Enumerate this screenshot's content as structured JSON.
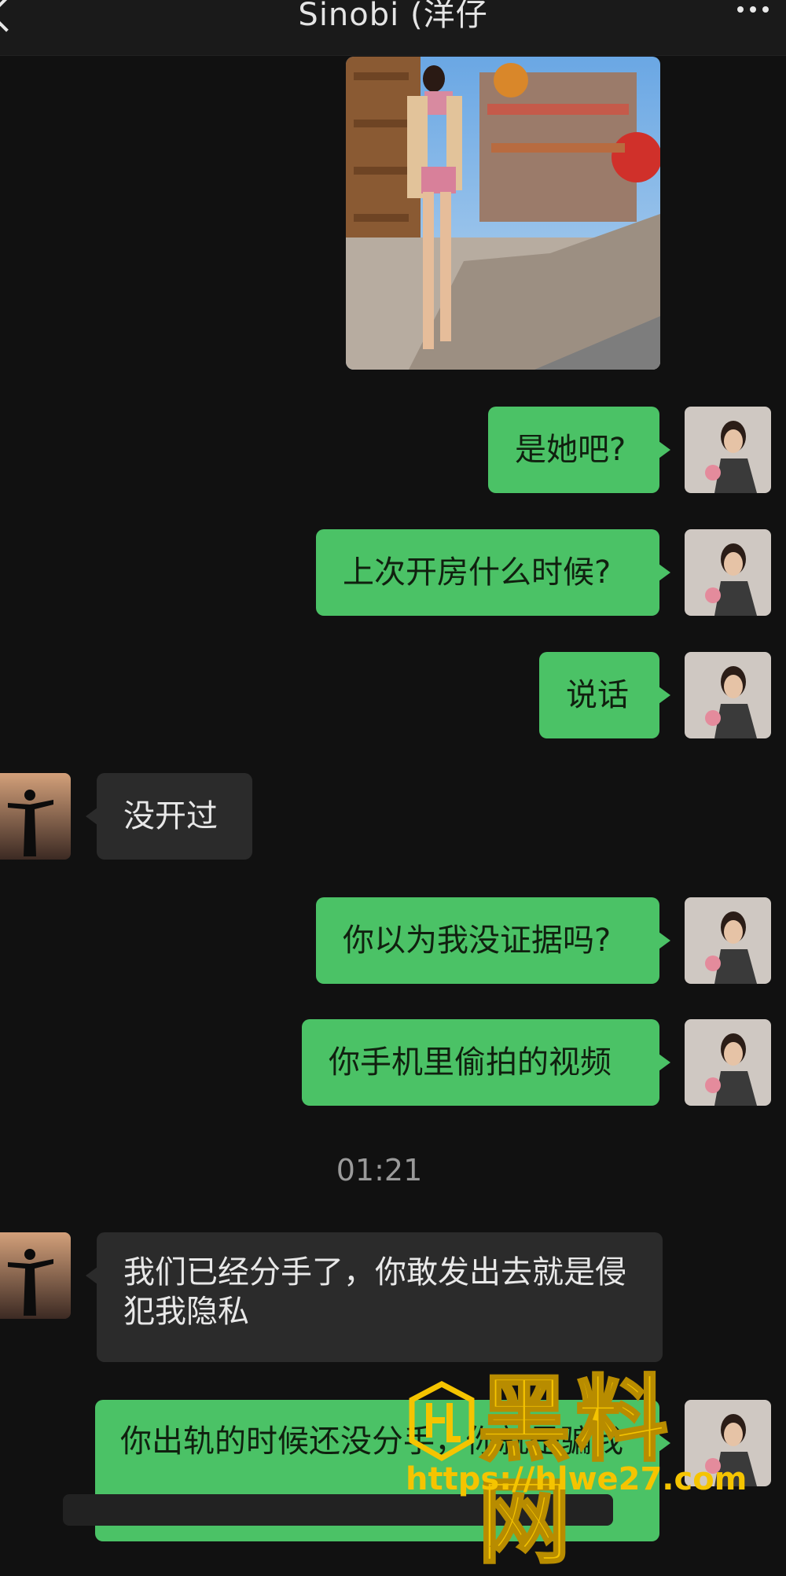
{
  "header": {
    "title": "Sinobi (洋仔"
  },
  "messages": {
    "m1": "是她吧?",
    "m2": "上次开房什么时候?",
    "m3": "说话",
    "m4": "没开过",
    "m5": "你以为我没证据吗?",
    "m6": "你手机里偷拍的视频",
    "time": "01:21",
    "m7": "我们已经分手了，你敢发出去就是侵犯我隐私",
    "m8": "你出轨的时候还没分手，你就是骗我"
  },
  "watermark": {
    "logo": "黑料网",
    "url": "https://hlwe27.com"
  },
  "colors": {
    "sent_bubble": "#4bc266",
    "recv_bubble": "#2b2b2b",
    "background": "#111111",
    "watermark": "#f5c400"
  }
}
